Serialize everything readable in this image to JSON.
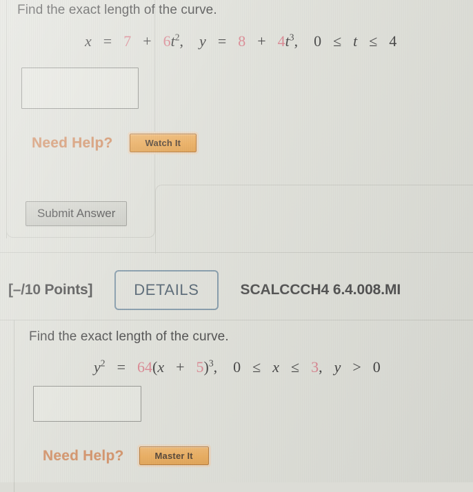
{
  "questions": [
    {
      "prompt": "Find the exact length of the curve.",
      "equation": {
        "text": "x = 7 + 6t²,  y = 8 + 4t³,  0 ≤ t ≤ 4",
        "parts": {
          "lhs_var_1": "x",
          "eq_1": "=",
          "const_1": "7",
          "plus_1": "+",
          "coef_1": "6",
          "var_t_1": "t",
          "exp_1": "2",
          "comma_1": ",",
          "lhs_var_2": "y",
          "eq_2": "=",
          "const_2": "8",
          "plus_2": "+",
          "coef_2": "4",
          "var_t_2": "t",
          "exp_2": "3",
          "comma_2": ",",
          "domain_lo": "0",
          "le_1": "≤",
          "domain_var": "t",
          "le_2": "≤",
          "domain_hi": "4"
        }
      },
      "answer_value": "",
      "need_help_label": "Need Help?",
      "help_button_label": "Watch It",
      "submit_label": "Submit Answer"
    },
    {
      "points_label": "[–/10 Points]",
      "details_label": "DETAILS",
      "assignment_code": "SCALCCCH4 6.4.008.MI",
      "prompt": "Find the exact length of the curve.",
      "equation": {
        "text": "y² = 64(x + 5)³,  0 ≤ x ≤ 3, y > 0",
        "parts": {
          "lhs_var": "y",
          "lhs_exp": "2",
          "eq": "=",
          "coef": "64",
          "open_paren": "(",
          "inner_var": "x",
          "plus": "+",
          "inner_const": "5",
          "close_paren": ")",
          "outer_exp": "3",
          "comma_1": ",",
          "domain_lo": "0",
          "le_1": "≤",
          "domain_var": "x",
          "le_2": "≤",
          "domain_hi": "3",
          "comma_2": ",",
          "pos_var": "y",
          "gt": ">",
          "pos_val": "0"
        }
      },
      "answer_value": "",
      "need_help_label": "Need Help?",
      "help_button_label": "Master It"
    }
  ],
  "colors": {
    "page_background": "#dedfd8",
    "need_help_text": "#d08d62",
    "help_button_fill": "#e9a957",
    "help_button_border": "#b07333",
    "details_border": "#7f96a6",
    "details_text": "#4e5f6d",
    "equation_number": "#d8818c",
    "body_text": "#454545",
    "answer_box_border": "#8e8f8a",
    "divider": "#c8c9c2"
  }
}
